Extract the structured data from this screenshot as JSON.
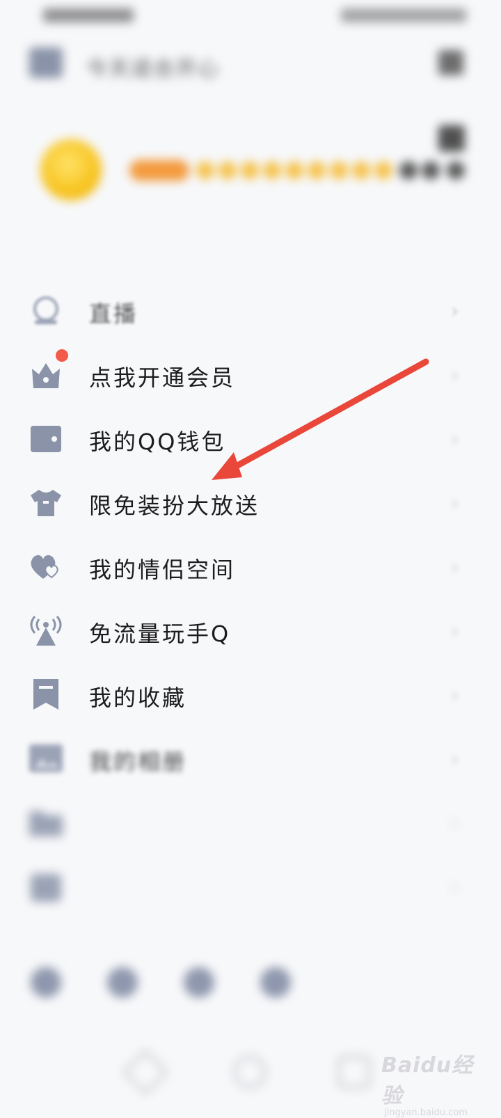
{
  "status_bar": {
    "left": "",
    "right": ""
  },
  "header": {
    "weather_text": "今天适合开心",
    "qr_icon": "qr-code-icon",
    "close_icon": "close-icon"
  },
  "profile": {
    "nickname": "",
    "signature": "",
    "card_icon": "profile-card-icon"
  },
  "menu": {
    "items": [
      {
        "label": "直播",
        "icon": "live-icon",
        "blurred": true
      },
      {
        "label": "点我开通会员",
        "icon": "vip-crown-icon",
        "badge_dot": true
      },
      {
        "label": "我的QQ钱包",
        "icon": "wallet-icon"
      },
      {
        "label": "限免装扮大放送",
        "icon": "tshirt-icon"
      },
      {
        "label": "我的情侣空间",
        "icon": "hearts-icon"
      },
      {
        "label": "免流量玩手Q",
        "icon": "signal-tower-icon"
      },
      {
        "label": "我的收藏",
        "icon": "bookmark-icon"
      },
      {
        "label": "我的相册",
        "icon": "album-icon",
        "blurred": true
      },
      {
        "label": "",
        "icon": "folder-icon",
        "blurred": true
      },
      {
        "label": "",
        "icon": "calendar-icon",
        "blurred": true
      }
    ]
  },
  "bottom_bar": {
    "items": [
      {
        "label": "",
        "icon": "settings-icon"
      },
      {
        "label": "",
        "icon": "night-mode-icon"
      },
      {
        "label": "",
        "icon": "weather-icon"
      },
      {
        "label": "",
        "icon": "photo-icon"
      }
    ]
  },
  "annotation": {
    "color": "#e8473a"
  },
  "watermark": {
    "brand": "Baidu经验",
    "url": "jingyan.baidu.com"
  }
}
